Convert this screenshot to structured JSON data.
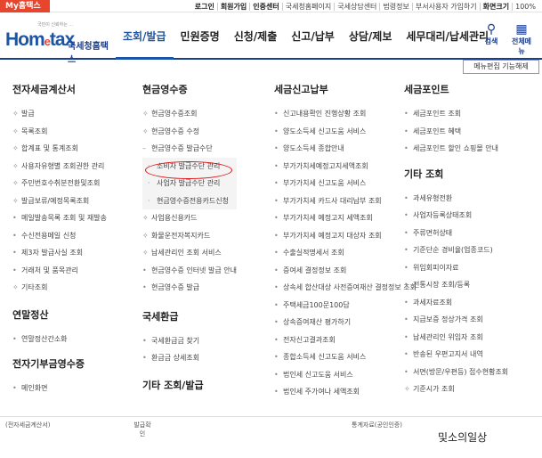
{
  "topbar": {
    "my_tab": "My홈택스",
    "links": [
      "로그인",
      "회원가입",
      "인증센터",
      "국세청홈페이지",
      "국세상담센터",
      "법령정보",
      "부서사용자 가입하기",
      "화면크기",
      "100%"
    ]
  },
  "header": {
    "logo_sub": "국민이 신뢰하는 ...",
    "logo_text": "Hometax",
    "logo_kr": "국세청홈택스",
    "menu": [
      "조회/발급",
      "민원증명",
      "신청/제출",
      "신고/납부",
      "상담/제보",
      "세무대리/납세관리"
    ],
    "search_label": "검색",
    "allmenu_label": "전체메뉴"
  },
  "menu_edit_button": "메뉴편집 기능해제",
  "col1": {
    "title": "전자세금계산서",
    "items": [
      "발급",
      "목록조회",
      "합계표 및 통계조회",
      "사용자유형별 조회권한 관리",
      "주민번호수취분전환및조회",
      "발급보류/예정목록조회",
      "메일발송목록 조회 및 재발송",
      "수신전용메일 신청",
      "제3자 발급사실 조회",
      "거래처 및 품목관리",
      "기타조회"
    ],
    "sec2_title": "연말정산",
    "sec2_items": [
      "연말정산간소화"
    ],
    "sec3_title": "전자기부금영수증",
    "sec3_items": [
      "메인화면"
    ]
  },
  "col2": {
    "title": "현금영수증",
    "items": [
      "현금영수증조회",
      "현금영수증 수정",
      "현금영수증 발급수단"
    ],
    "sub_items": [
      "소비자 발급수단 관리",
      "사업자 발급수단 관리",
      "현금영수증전용카드신청"
    ],
    "items2": [
      "사업용신용카드",
      "화물운전자복지카드",
      "납세관리인 조회 서비스",
      "현금영수증 인터넷 발급 안내",
      "현금영수증 발급"
    ],
    "sec2_title": "국세환급",
    "sec2_items": [
      "국세환급금 찾기",
      "환급금 상세조회"
    ],
    "sec3_title": "기타 조회/발급"
  },
  "col3": {
    "title": "세금신고납부",
    "items": [
      "신고내용확인 진행상황 조회",
      "양도소득세 신고도움 서비스",
      "양도소득세 종합안내",
      "부가가치세예정고지세액조회",
      "부가가치세 신고도움 서비스",
      "부가가치세 카드사 대리납부 조회",
      "부가가치세 예정고지 세액조회",
      "부가가치세 예정고지 대상자 조회",
      "수출실적명세서 조회",
      "증여세 결정정보 조회",
      "상속세 합산대상 사전증여재산 결정정보 조회",
      "주택세금100문100답",
      "상속증여재산 평가하기",
      "전자신고결과조회",
      "종합소득세 신고도움 서비스",
      "법인세 신고도움 서비스",
      "법인세 주가여나 세액조회"
    ]
  },
  "col4": {
    "title": "세금포인트",
    "items": [
      "세금포인트 조회",
      "세금포인트 혜택",
      "세금포인트 할인 쇼핑몰 안내"
    ],
    "sec2_title": "기타 조회",
    "sec2_items": [
      "과세유형전환",
      "사업자등록상태조회",
      "주류면허상태",
      "기준단순 경비율(업종코드)",
      "위임회피이자료",
      "전통시장 조회/등록",
      "과세자료조회",
      "지급보증 정상가격 조회",
      "납세관리인 위임자 조회",
      "반송된 우편고지서 내역",
      "서면(방문/우편등) 접수현황조회",
      "기준시가 조회"
    ]
  },
  "bottom": {
    "b1": "(전자세금계산서)",
    "b2": "발급확인",
    "b3": "통계자료(공인인증)"
  },
  "watermark": "및소의일상"
}
